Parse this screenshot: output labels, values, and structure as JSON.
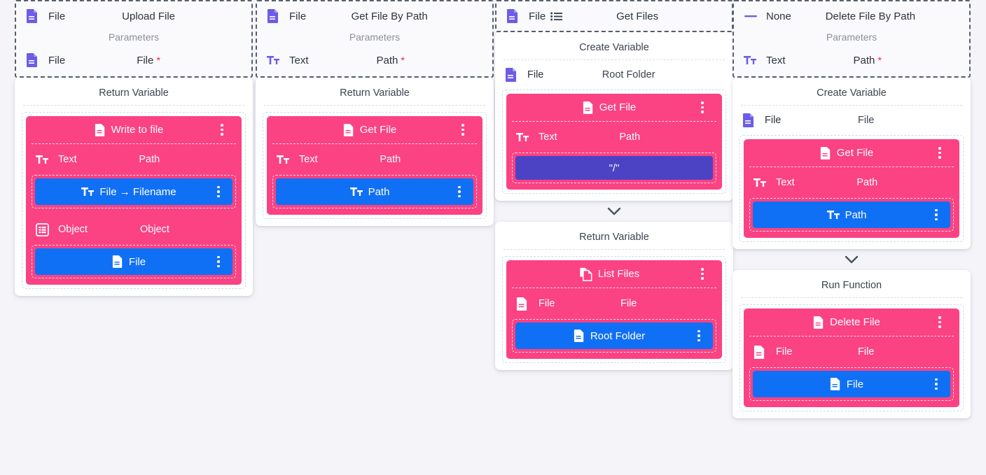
{
  "theme": {
    "background": "#f4f4f9",
    "card_bg": "#ffffff",
    "pink": "#fb4283",
    "blue": "#1070f5",
    "purple": "#4b43c3",
    "signature_border": "#57606a",
    "required_marker": "#e0244b",
    "icon_purple": "#6c5ce7",
    "muted_text": "#8a8f98"
  },
  "columns": [
    {
      "id": "upload-file",
      "signature": {
        "return_type": "File",
        "return_type_icon": "file-icon",
        "name": "Upload File",
        "parameters_label": "Parameters",
        "parameters": [
          {
            "type": "File",
            "type_icon": "file-icon",
            "name": "File",
            "required": "*"
          }
        ]
      },
      "card": {
        "title": "Return Variable",
        "node": {
          "label": "Write to file",
          "icon": "file-icon",
          "menu_icon": "kebab-menu-icon",
          "rows": [
            {
              "type": "Text",
              "type_icon": "text-format-icon",
              "name": "Path",
              "value": {
                "kind": "blue",
                "label": "File → Filename",
                "icon": "text-format-icon",
                "menu_icon": "kebab-menu-icon"
              }
            },
            {
              "type": "Object",
              "type_icon": "object-grid-icon",
              "name": "Object",
              "value": {
                "kind": "blue",
                "label": "File",
                "icon": "file-icon",
                "menu_icon": "kebab-menu-icon"
              }
            }
          ]
        }
      }
    },
    {
      "id": "get-file-by-path",
      "signature": {
        "return_type": "File",
        "return_type_icon": "file-icon",
        "name": "Get File By Path",
        "parameters_label": "Parameters",
        "parameters": [
          {
            "type": "Text",
            "type_icon": "text-format-icon",
            "name": "Path",
            "required": "*"
          }
        ]
      },
      "card": {
        "title": "Return Variable",
        "node": {
          "label": "Get File",
          "icon": "file-icon",
          "menu_icon": "kebab-menu-icon",
          "rows": [
            {
              "type": "Text",
              "type_icon": "text-format-icon",
              "name": "Path",
              "value": {
                "kind": "blue",
                "label": "Path",
                "icon": "text-format-icon",
                "menu_icon": "kebab-menu-icon"
              }
            }
          ]
        }
      }
    },
    {
      "id": "get-files",
      "signature": {
        "return_type": "File",
        "return_type_icon": "file-icon",
        "return_type_suffix_icon": "list-icon",
        "name": "Get Files",
        "parameters_label": "",
        "parameters": []
      },
      "card": {
        "title": "Create Variable",
        "variable": {
          "type": "File",
          "type_icon": "file-icon",
          "name": "Root Folder"
        },
        "node": {
          "label": "Get File",
          "icon": "file-icon",
          "menu_icon": "kebab-menu-icon",
          "rows": [
            {
              "type": "Text",
              "type_icon": "text-format-icon",
              "name": "Path",
              "value": {
                "kind": "purple",
                "label": "\"/\""
              }
            }
          ]
        }
      },
      "connector_icon": "chevron-down-icon",
      "card2": {
        "title": "Return Variable",
        "node": {
          "label": "List Files",
          "icon": "copy-files-icon",
          "menu_icon": "kebab-menu-icon",
          "rows": [
            {
              "type": "File",
              "type_icon": "file-icon",
              "name": "File",
              "value": {
                "kind": "blue",
                "label": "Root Folder",
                "icon": "file-icon",
                "menu_icon": "kebab-menu-icon"
              }
            }
          ]
        }
      }
    },
    {
      "id": "delete-file-by-path",
      "signature": {
        "return_type": "None",
        "return_type_icon": "none-dash-icon",
        "name": "Delete File By Path",
        "parameters_label": "Parameters",
        "parameters": [
          {
            "type": "Text",
            "type_icon": "text-format-icon",
            "name": "Path",
            "required": "*"
          }
        ]
      },
      "card": {
        "title": "Create Variable",
        "variable": {
          "type": "File",
          "type_icon": "file-icon",
          "name": "File"
        },
        "node": {
          "label": "Get File",
          "icon": "file-icon",
          "menu_icon": "kebab-menu-icon",
          "rows": [
            {
              "type": "Text",
              "type_icon": "text-format-icon",
              "name": "Path",
              "value": {
                "kind": "blue",
                "label": "Path",
                "icon": "text-format-icon",
                "menu_icon": "kebab-menu-icon"
              }
            }
          ]
        }
      },
      "connector_icon": "chevron-down-icon",
      "card2": {
        "title": "Run Function",
        "node": {
          "label": "Delete File",
          "icon": "file-icon",
          "menu_icon": "kebab-menu-icon",
          "rows": [
            {
              "type": "File",
              "type_icon": "file-icon",
              "name": "File",
              "value": {
                "kind": "blue",
                "label": "File",
                "icon": "file-icon",
                "menu_icon": "kebab-menu-icon"
              }
            }
          ]
        }
      }
    }
  ]
}
